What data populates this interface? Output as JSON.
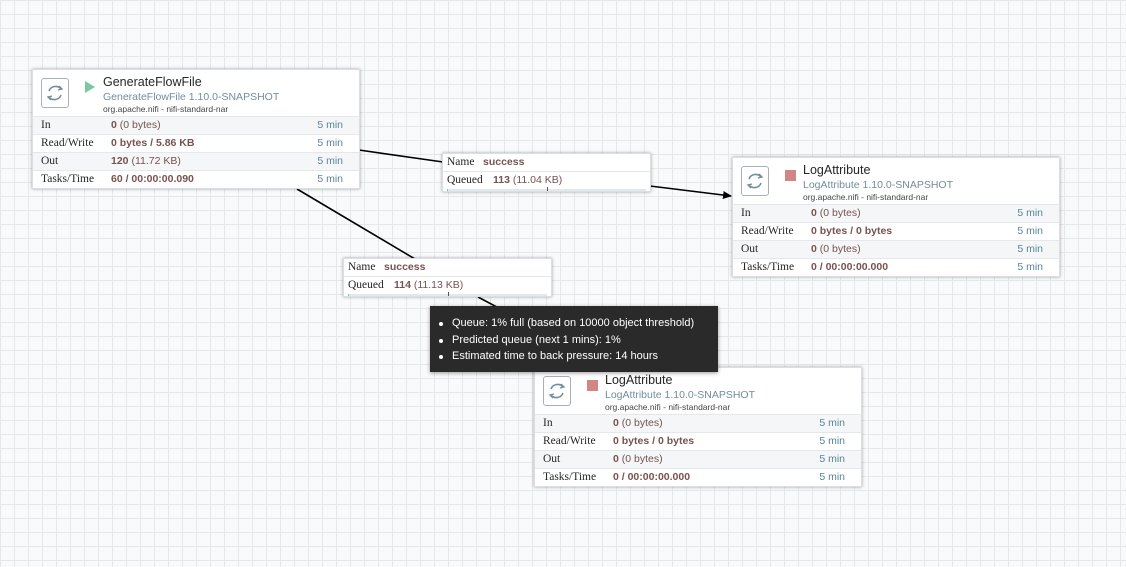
{
  "processors": [
    {
      "id": "p1",
      "name": "GenerateFlowFile",
      "type": "GenerateFlowFile 1.10.0-SNAPSHOT",
      "bundle": "org.apache.nifi - nifi-standard-nar",
      "state": "running",
      "stats": [
        {
          "label": "In",
          "value": "0",
          "sub": " (0 bytes)",
          "period": "5 min"
        },
        {
          "label": "Read/Write",
          "value": "0 bytes / 5.86 KB",
          "sub": "",
          "period": "5 min"
        },
        {
          "label": "Out",
          "value": "120",
          "sub": " (11.72 KB)",
          "period": "5 min"
        },
        {
          "label": "Tasks/Time",
          "value": "60 / 00:00:00.090",
          "sub": "",
          "period": "5 min"
        }
      ]
    },
    {
      "id": "p2",
      "name": "LogAttribute",
      "type": "LogAttribute 1.10.0-SNAPSHOT",
      "bundle": "org.apache.nifi - nifi-standard-nar",
      "state": "stopped",
      "stats": [
        {
          "label": "In",
          "value": "0",
          "sub": " (0 bytes)",
          "period": "5 min"
        },
        {
          "label": "Read/Write",
          "value": "0 bytes / 0 bytes",
          "sub": "",
          "period": "5 min"
        },
        {
          "label": "Out",
          "value": "0",
          "sub": " (0 bytes)",
          "period": "5 min"
        },
        {
          "label": "Tasks/Time",
          "value": "0 / 00:00:00.000",
          "sub": "",
          "period": "5 min"
        }
      ]
    },
    {
      "id": "p3",
      "name": "LogAttribute",
      "type": "LogAttribute 1.10.0-SNAPSHOT",
      "bundle": "org.apache.nifi - nifi-standard-nar",
      "state": "stopped",
      "stats": [
        {
          "label": "In",
          "value": "0",
          "sub": " (0 bytes)",
          "period": "5 min"
        },
        {
          "label": "Read/Write",
          "value": "0 bytes / 0 bytes",
          "sub": "",
          "period": "5 min"
        },
        {
          "label": "Out",
          "value": "0",
          "sub": " (0 bytes)",
          "period": "5 min"
        },
        {
          "label": "Tasks/Time",
          "value": "0 / 00:00:00.000",
          "sub": "",
          "period": "5 min"
        }
      ]
    }
  ],
  "connections": [
    {
      "id": "c1",
      "name_label": "Name",
      "name": "success",
      "queued_label": "Queued",
      "queued_count": "113",
      "queued_size": " (11.04 KB)",
      "backpressure_count_pct": 1,
      "backpressure_size_pct": 1
    },
    {
      "id": "c2",
      "name_label": "Name",
      "name": "success",
      "queued_label": "Queued",
      "queued_count": "114",
      "queued_size": " (11.13 KB)",
      "backpressure_count_pct": 1,
      "backpressure_size_pct": 1
    }
  ],
  "tooltip": {
    "items": [
      "Queue: 1% full (based on 10000 object threshold)",
      "Predicted queue (next 1 mins): 1%",
      "Estimated time to back pressure: 14 hours"
    ]
  },
  "colors": {
    "running": "#7dc7a0",
    "stopped": "#d18686",
    "stat_value": "#775351",
    "type_text": "#728e9b",
    "period_text": "#598599"
  }
}
